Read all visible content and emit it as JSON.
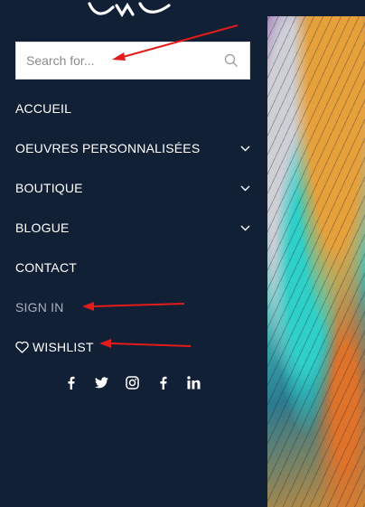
{
  "search": {
    "placeholder": "Search for..."
  },
  "menu": {
    "items": [
      {
        "label": "ACCUEIL"
      },
      {
        "label": "OEUVRES PERSONNALISÉES"
      },
      {
        "label": "BOUTIQUE"
      },
      {
        "label": "BLOGUE"
      },
      {
        "label": "CONTACT"
      },
      {
        "label": "SIGN IN"
      },
      {
        "label": "WISHLIST"
      }
    ]
  },
  "socials": [
    "facebook-icon",
    "twitter-icon",
    "instagram-icon",
    "facebook-icon",
    "linkedin-icon"
  ],
  "colors": {
    "drawer_bg": "#122036",
    "annotation": "#e21b1b",
    "muted_text": "#a7afbd"
  }
}
